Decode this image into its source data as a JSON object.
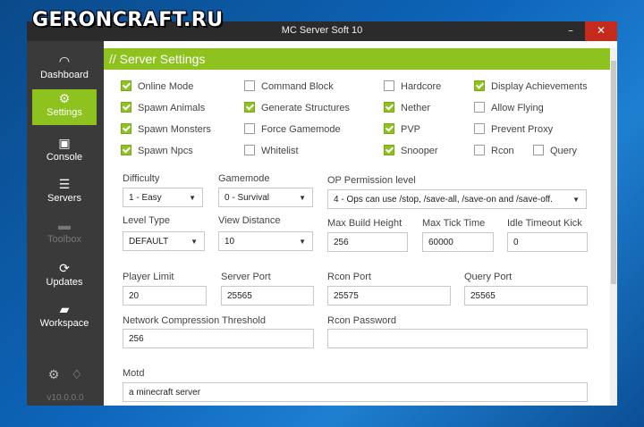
{
  "watermark": "GERONCRAFT.RU",
  "window": {
    "title": "MC Server Soft 10",
    "min": "–",
    "max": "☐",
    "close": "✕"
  },
  "sidebar": {
    "items": [
      {
        "label": "Dashboard",
        "icon": "gauge-icon"
      },
      {
        "label": "Settings",
        "icon": "gears-icon"
      },
      {
        "label": "Console",
        "icon": "terminal-icon"
      },
      {
        "label": "Servers",
        "icon": "servers-icon"
      },
      {
        "label": "Toolbox",
        "icon": "toolbox-icon"
      },
      {
        "label": "Updates",
        "icon": "refresh-icon"
      },
      {
        "label": "Workspace",
        "icon": "folder-icon"
      }
    ],
    "version": "v10.0.0.0"
  },
  "header": {
    "title": "// Server Settings"
  },
  "checkboxes": [
    {
      "label": "Online Mode",
      "checked": true
    },
    {
      "label": "Command Block",
      "checked": false
    },
    {
      "label": "Hardcore",
      "checked": false
    },
    {
      "label": "Display Achievements",
      "checked": true
    },
    {
      "label": "Spawn Animals",
      "checked": true
    },
    {
      "label": "Generate Structures",
      "checked": true
    },
    {
      "label": "Nether",
      "checked": true
    },
    {
      "label": "Allow Flying",
      "checked": false
    },
    {
      "label": "Spawn Monsters",
      "checked": true
    },
    {
      "label": "Force Gamemode",
      "checked": false
    },
    {
      "label": "PVP",
      "checked": true
    },
    {
      "label": "Prevent Proxy",
      "checked": false
    },
    {
      "label": "Spawn Npcs",
      "checked": true
    },
    {
      "label": "Whitelist",
      "checked": false
    },
    {
      "label": "Snooper",
      "checked": true
    },
    {
      "label": "Rcon",
      "checked": false
    },
    {
      "label": "Query",
      "checked": false
    }
  ],
  "fields": {
    "difficulty": {
      "label": "Difficulty",
      "value": "1 - Easy"
    },
    "gamemode": {
      "label": "Gamemode",
      "value": "0 - Survival"
    },
    "op_level": {
      "label": "OP Permission level",
      "value": "4 - Ops can use /stop, /save-all, /save-on and /save-off."
    },
    "level_type": {
      "label": "Level Type",
      "value": "DEFAULT"
    },
    "view_distance": {
      "label": "View Distance",
      "value": "10"
    },
    "max_build_height": {
      "label": "Max Build Height",
      "value": "256"
    },
    "max_tick_time": {
      "label": "Max Tick Time",
      "value": "60000"
    },
    "idle_timeout": {
      "label": "Idle Timeout Kick",
      "value": "0"
    },
    "player_limit": {
      "label": "Player Limit",
      "value": "20"
    },
    "server_port": {
      "label": "Server Port",
      "value": "25565"
    },
    "rcon_port": {
      "label": "Rcon Port",
      "value": "25575"
    },
    "query_port": {
      "label": "Query Port",
      "value": "25565"
    },
    "network_compression": {
      "label": "Network Compression Threshold",
      "value": "256"
    },
    "rcon_password": {
      "label": "Rcon Password",
      "value": ""
    },
    "motd": {
      "label": "Motd",
      "value": "a minecraft server"
    }
  },
  "colors": {
    "accent": "#8dc21f",
    "sidebar": "#3a3a3a",
    "titlebar": "#2b2b2b",
    "close": "#c42b1c"
  }
}
